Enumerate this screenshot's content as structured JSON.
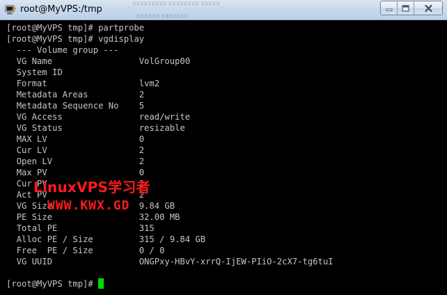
{
  "window": {
    "title": "root@MyVPS:/tmp",
    "background_text": [
      "XXXXXXXXX  XXXXXXXX XXXXX",
      "XXXXXX  XXXXXXX"
    ],
    "buttons": {
      "minimize": "minimize-icon",
      "maximize": "maximize-icon",
      "close": "close-icon"
    }
  },
  "terminal": {
    "colors": {
      "background": "#000000",
      "text": "#c6c6c6",
      "cursor": "#00d800"
    },
    "lines": [
      "[root@MyVPS tmp]# partprobe",
      "[root@MyVPS tmp]# vgdisplay",
      "  --- Volume group ---"
    ],
    "vg": [
      {
        "key": "VG Name",
        "value": "VolGroup00"
      },
      {
        "key": "System ID",
        "value": ""
      },
      {
        "key": "Format",
        "value": "lvm2"
      },
      {
        "key": "Metadata Areas",
        "value": "2"
      },
      {
        "key": "Metadata Sequence No",
        "value": "5"
      },
      {
        "key": "VG Access",
        "value": "read/write"
      },
      {
        "key": "VG Status",
        "value": "resizable"
      },
      {
        "key": "MAX LV",
        "value": "0"
      },
      {
        "key": "Cur LV",
        "value": "2"
      },
      {
        "key": "Open LV",
        "value": "2"
      },
      {
        "key": "Max PV",
        "value": "0"
      },
      {
        "key": "Cur PV",
        "value": "2"
      },
      {
        "key": "Act PV",
        "value": "2"
      },
      {
        "key": "VG Size",
        "value": "9.84 GB"
      },
      {
        "key": "PE Size",
        "value": "32.00 MB"
      },
      {
        "key": "Total PE",
        "value": "315"
      },
      {
        "key": "Alloc PE / Size",
        "value": "315 / 9.84 GB"
      },
      {
        "key": "Free  PE / Size",
        "value": "0 / 0"
      },
      {
        "key": "VG UUID",
        "value": "ONGPxy-HBvY-xrrQ-IjEW-PIiO-2cX7-tg6tuI"
      }
    ],
    "prompt": "[root@MyVPS tmp]# "
  },
  "watermark": {
    "line1": "LinuxVPS学习者",
    "line2": "WWW.KWX.GD",
    "color": "#ff1a1a"
  }
}
